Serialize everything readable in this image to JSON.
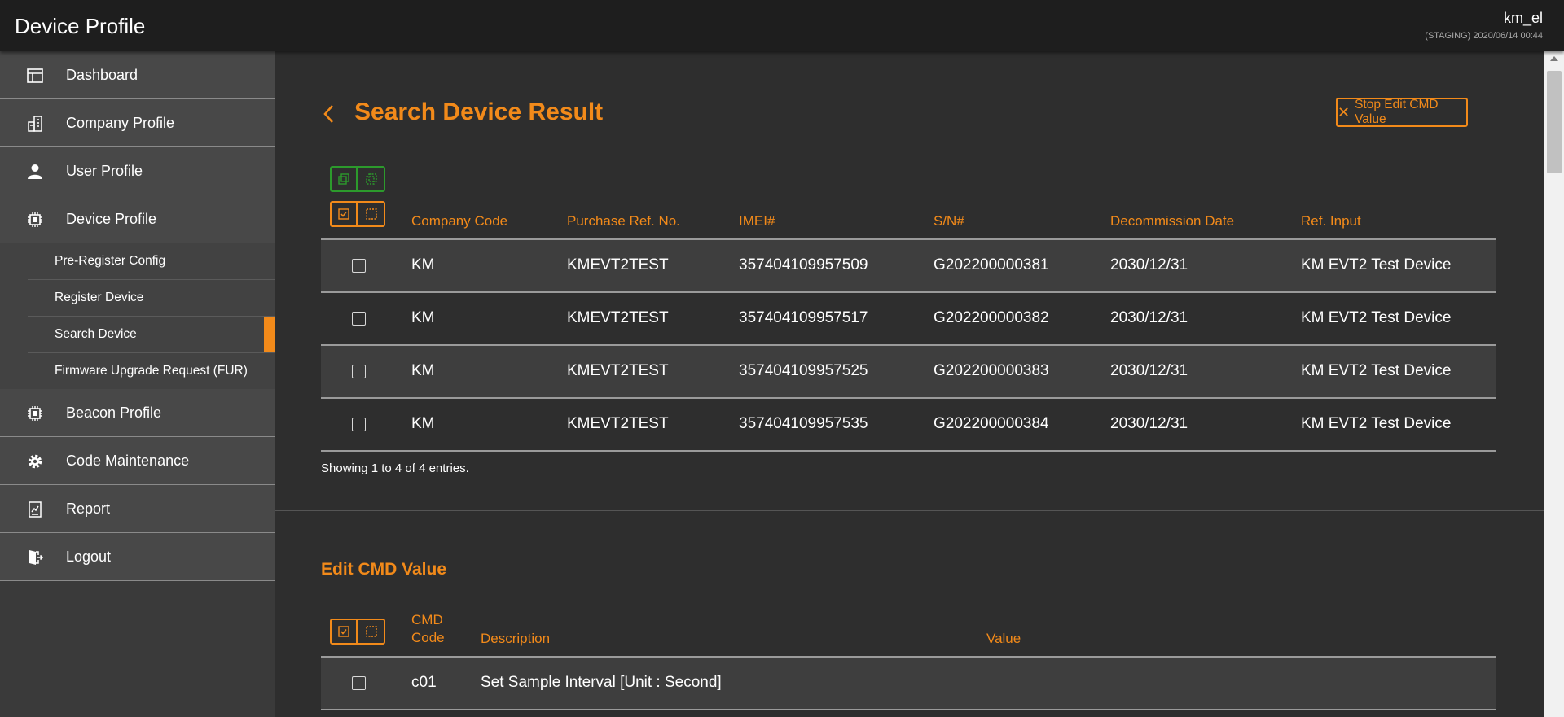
{
  "header": {
    "app_title": "Device Profile",
    "user_name": "km_el",
    "env_info": "(STAGING) 2020/06/14 00:44"
  },
  "sidebar": {
    "items": [
      {
        "label": "Dashboard",
        "icon": "dashboard-icon"
      },
      {
        "label": "Company Profile",
        "icon": "building-icon"
      },
      {
        "label": "User Profile",
        "icon": "user-icon"
      },
      {
        "label": "Device Profile",
        "icon": "chip-icon"
      },
      {
        "label": "Beacon Profile",
        "icon": "chip-icon"
      },
      {
        "label": "Code Maintenance",
        "icon": "gear-icon"
      },
      {
        "label": "Report",
        "icon": "report-icon"
      },
      {
        "label": "Logout",
        "icon": "logout-icon"
      }
    ],
    "device_subitems": [
      {
        "label": "Pre-Register Config"
      },
      {
        "label": "Register Device"
      },
      {
        "label": "Search Device",
        "active": true
      },
      {
        "label": "Firmware Upgrade Request (FUR)"
      }
    ]
  },
  "page": {
    "title": "Search Device Result",
    "stop_button_label": "Stop Edit CMD Value"
  },
  "device_table": {
    "columns": [
      "Company Code",
      "Purchase Ref. No.",
      "IMEI#",
      "S/N#",
      "Decommission Date",
      "Ref. Input"
    ],
    "rows": [
      [
        "KM",
        "KMEVT2TEST",
        "357404109957509",
        "G202200000381",
        "2030/12/31",
        "KM EVT2 Test Device"
      ],
      [
        "KM",
        "KMEVT2TEST",
        "357404109957517",
        "G202200000382",
        "2030/12/31",
        "KM EVT2 Test Device"
      ],
      [
        "KM",
        "KMEVT2TEST",
        "357404109957525",
        "G202200000383",
        "2030/12/31",
        "KM EVT2 Test Device"
      ],
      [
        "KM",
        "KMEVT2TEST",
        "357404109957535",
        "G202200000384",
        "2030/12/31",
        "KM EVT2 Test Device"
      ]
    ],
    "entries_text": "Showing 1 to 4 of 4 entries."
  },
  "cmd_section": {
    "title": "Edit CMD Value",
    "columns": {
      "code_line1": "CMD",
      "code_line2": "Code",
      "description": "Description",
      "value": "Value"
    },
    "rows": [
      {
        "code": "c01",
        "description": "Set Sample Interval [Unit : Second]",
        "value": ""
      }
    ]
  },
  "colors": {
    "accent": "#f28a1a",
    "green": "#2c9a2c",
    "background": "#2e2e2e",
    "topbar": "#1e1e1e"
  }
}
